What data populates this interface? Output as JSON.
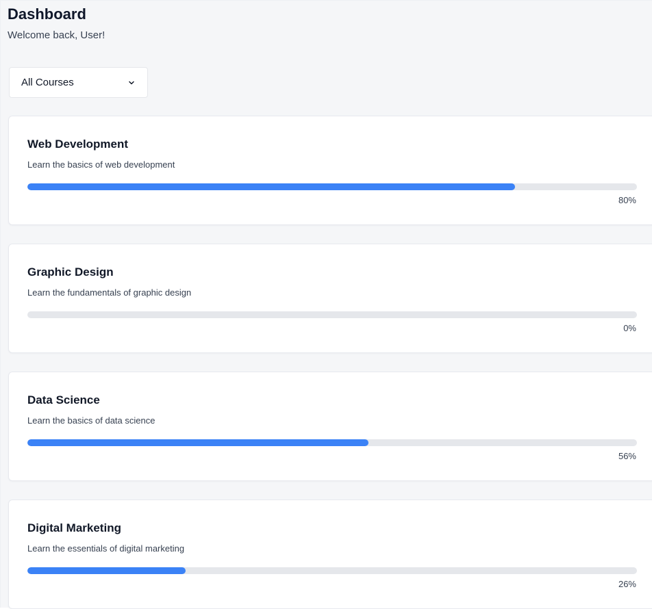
{
  "header": {
    "title": "Dashboard",
    "subtitle": "Welcome back, User!"
  },
  "filter": {
    "selected": "All Courses",
    "icon": "chevron-down-icon"
  },
  "colors": {
    "accent": "#3b82f6",
    "track": "#e5e7eb",
    "background": "#f5f6f8"
  },
  "courses": [
    {
      "title": "Web Development",
      "description": "Learn the basics of web development",
      "progress": 80,
      "progress_label": "80%"
    },
    {
      "title": "Graphic Design",
      "description": "Learn the fundamentals of graphic design",
      "progress": 0,
      "progress_label": "0%"
    },
    {
      "title": "Data Science",
      "description": "Learn the basics of data science",
      "progress": 56,
      "progress_label": "56%"
    },
    {
      "title": "Digital Marketing",
      "description": "Learn the essentials of digital marketing",
      "progress": 26,
      "progress_label": "26%"
    }
  ]
}
